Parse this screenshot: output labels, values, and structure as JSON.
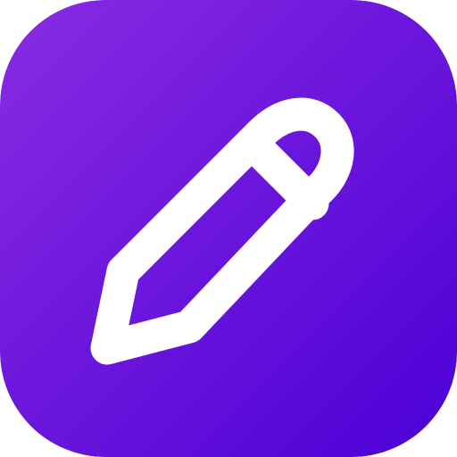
{
  "icon": {
    "name": "pencil-icon",
    "glyph_color": "#ffffff",
    "gradient": {
      "start": "#8a2be2",
      "end": "#4b00d6"
    }
  }
}
